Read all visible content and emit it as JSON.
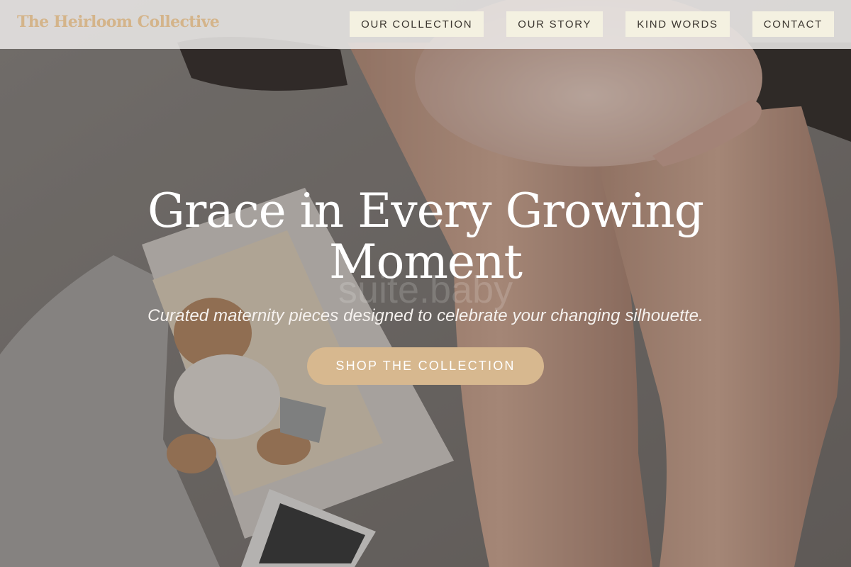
{
  "header": {
    "brand": "The Heirloom Collective",
    "nav": [
      {
        "label": "OUR COLLECTION"
      },
      {
        "label": "OUR STORY"
      },
      {
        "label": "KIND WORDS"
      },
      {
        "label": "CONTACT"
      }
    ]
  },
  "hero": {
    "title": "Grace in Every Growing Moment",
    "subtitle": "Curated maternity pieces designed to celebrate your changing silhouette.",
    "cta_label": "SHOP THE COLLECTION",
    "photo_watermark": "suite.baby"
  },
  "colors": {
    "brand": "#d4b48a",
    "cta_background": "#d7b88f",
    "nav_button_background": "#f4f1e1",
    "header_background": "#eceae9"
  }
}
